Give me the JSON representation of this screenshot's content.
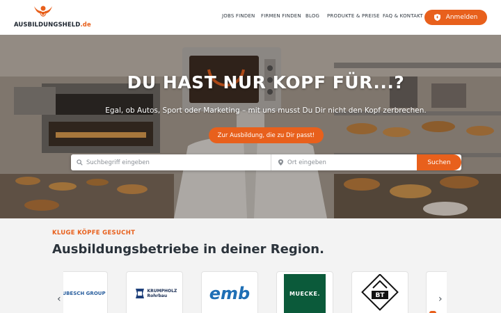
{
  "header": {
    "logo_text": "AUSBILDUNGSHELD",
    "logo_suffix": ".de",
    "nav": [
      "JOBS FINDEN",
      "FIRMEN FINDEN",
      "BLOG",
      "PRODUKTE & PREISE",
      "FAQ & KONTAKT"
    ],
    "login_label": "Anmelden"
  },
  "hero": {
    "title": "DU HAST NUR KOPF FÜR...?",
    "subtitle": "Egal, ob Autos, Sport oder Marketing – mit uns musst Du Dir nicht den Kopf zerbrechen.",
    "cta_label": "Zur Ausbildung, die zu Dir passt!",
    "search_placeholder": "Suchbegriff eingeben",
    "location_placeholder": "Ort eingeben",
    "search_button": "Suchen"
  },
  "section": {
    "kicker": "KLUGE KÖPFE GESUCHT",
    "title": "Ausbildungsbetriebe in deiner Region."
  },
  "companies": [
    "UBESCH GROUP",
    "KRUMPHOLZ Rohrbau",
    "emb",
    "MUECKE.",
    "BT"
  ],
  "colors": {
    "accent": "#e8601c",
    "text_dark": "#2b333b",
    "background": "#f3f3f3"
  },
  "icons": [
    "logo-mark-icon",
    "shield-icon",
    "search-icon",
    "location-pin-icon",
    "chevron-left-icon",
    "chevron-right-icon"
  ]
}
